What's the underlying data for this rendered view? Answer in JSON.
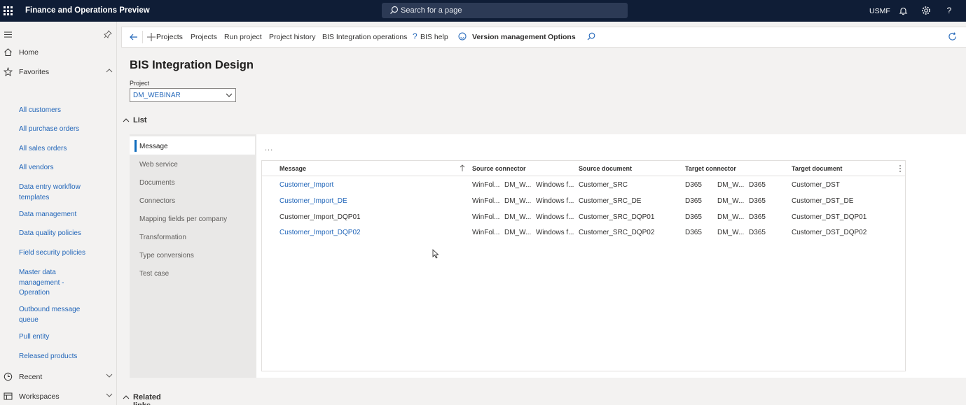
{
  "topbar": {
    "app_title": "Finance and Operations Preview",
    "search_placeholder": "Search for a page",
    "company": "USMF",
    "icons": [
      "waffle-icon",
      "search-icon",
      "bell-icon",
      "gear-icon",
      "help-icon"
    ]
  },
  "nav": {
    "home": "Home",
    "favorites": "Favorites",
    "favorite_links": [
      "All customers",
      "All purchase orders",
      "All sales orders",
      "All vendors",
      "Data entry workflow templates",
      "Data management",
      "Data quality policies",
      "Field security policies",
      "Master data management - Operation",
      "Outbound message queue",
      "Pull entity",
      "Released products"
    ],
    "recent": "Recent",
    "workspaces": "Workspaces"
  },
  "actionbar": {
    "new_projects": "Projects",
    "projects": "Projects",
    "run_project": "Run project",
    "project_history": "Project history",
    "bis_integration_operations": "BIS Integration operations",
    "bis_help": "BIS help",
    "version_management": "Version management",
    "options": "Options"
  },
  "page": {
    "title": "BIS Integration Design",
    "project_label": "Project",
    "project_value": "DM_WEBINAR",
    "list_section": "List",
    "related_section": "Related links"
  },
  "tabs": [
    "Message",
    "Web service",
    "Documents",
    "Connectors",
    "Mapping fields per company",
    "Transformation",
    "Type conversions",
    "Test case"
  ],
  "active_tab": "Message",
  "grid": {
    "more_label": "...",
    "headers": {
      "message": "Message",
      "source_connector": "Source connector",
      "source_document": "Source document",
      "target_connector": "Target connector",
      "target_document": "Target document"
    },
    "rows": [
      {
        "message": "Customer_Import",
        "sc1": "WinFol...",
        "sc2": "DM_W...",
        "sc3": "Windows f...",
        "source_document": "Customer_SRC",
        "tc1": "D365",
        "tc2": "DM_W...",
        "tc3": "D365",
        "target_document": "Customer_DST",
        "link": true
      },
      {
        "message": "Customer_Import_DE",
        "sc1": "WinFol...",
        "sc2": "DM_W...",
        "sc3": "Windows f...",
        "source_document": "Customer_SRC_DE",
        "tc1": "D365",
        "tc2": "DM_W...",
        "tc3": "D365",
        "target_document": "Customer_DST_DE",
        "link": true
      },
      {
        "message": "Customer_Import_DQP01",
        "sc1": "WinFol...",
        "sc2": "DM_W...",
        "sc3": "Windows f...",
        "source_document": "Customer_SRC_DQP01",
        "tc1": "D365",
        "tc2": "DM_W...",
        "tc3": "D365",
        "target_document": "Customer_DST_DQP01",
        "link": false
      },
      {
        "message": "Customer_Import_DQP02",
        "sc1": "WinFol...",
        "sc2": "DM_W...",
        "sc3": "Windows f...",
        "source_document": "Customer_SRC_DQP02",
        "tc1": "D365",
        "tc2": "DM_W...",
        "tc3": "D365",
        "target_document": "Customer_DST_DQP02",
        "link": true
      }
    ]
  },
  "colors": {
    "topbar": "#0f1d36",
    "link": "#2266b9",
    "accent": "#0f6cbd",
    "background": "#f3f2f1"
  }
}
